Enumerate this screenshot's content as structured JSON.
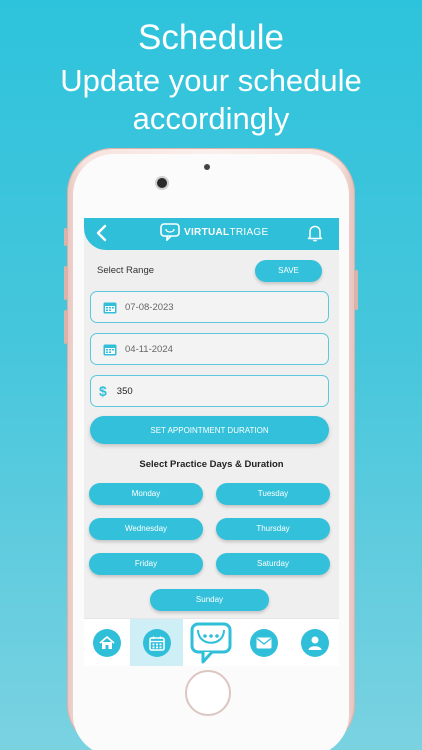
{
  "promo": {
    "title": "Schedule",
    "subtitle": "Update your schedule accordingly"
  },
  "header": {
    "logo_bold": "VIRTUAL",
    "logo_light": "TRIAGE"
  },
  "form": {
    "range_label": "Select Range",
    "save_label": "SAVE",
    "start_date": "07-08-2023",
    "end_date": "04-11-2024",
    "currency_symbol": "$",
    "fee": "350",
    "duration_button": "SET APPOINTMENT DURATION",
    "days_title": "Select Practice Days & Duration",
    "days": [
      "Monday",
      "Tuesday",
      "Wednesday",
      "Thursday",
      "Friday",
      "Saturday",
      "Sunday"
    ]
  },
  "tabs": [
    {
      "icon": "home-icon"
    },
    {
      "icon": "calendar-icon",
      "active": true
    },
    {
      "icon": "chat-stethoscope-icon"
    },
    {
      "icon": "mail-icon"
    },
    {
      "icon": "profile-icon"
    }
  ],
  "colors": {
    "accent": "#30bfd9",
    "background_top": "#2ec3dc",
    "background_bottom": "#7ad2e1",
    "active_tab": "#cdeff5"
  }
}
